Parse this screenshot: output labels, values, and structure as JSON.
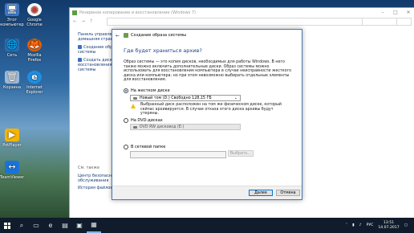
{
  "desktop": {
    "icons": [
      {
        "label": "Этот компьютер",
        "glyph": "🖥"
      },
      {
        "label": "Google Chrome",
        "glyph": "◉"
      },
      {
        "label": "Сеть",
        "glyph": "🌐"
      },
      {
        "label": "Mozilla Firefox",
        "glyph": "🦊"
      },
      {
        "label": "Корзина",
        "glyph": "🗑"
      },
      {
        "label": "Internet Explorer",
        "glyph": "e"
      },
      {
        "label": "PotPlayer",
        "glyph": "▶"
      },
      {
        "label": "TeamViewer",
        "glyph": "↔"
      }
    ]
  },
  "bg_window": {
    "title": "Резервное копирование и восстановление (Windows 7)",
    "left_pane": [
      "Панель управления — домашняя страница",
      "Создание образа системы",
      "Создать диск восстановления системы"
    ],
    "see_also_header": "См. также",
    "see_also": [
      "Центр безопасности и обслуживания",
      "История файлов"
    ]
  },
  "dialog": {
    "title": "Создание образа системы",
    "heading": "Где будет храниться архив?",
    "intro": "Образ системы — это копия дисков, необходимых для работы Windows. В него также можно включить дополнительные диски. Образ системы можно использовать для восстановления компьютера в случае неисправности жесткого диска или компьютера; но при этом невозможно выбирать отдельные элементы для восстановления.",
    "option_hdd": "На жестком диске",
    "hdd_selected": "Новый том (D:) Свободно 128,15 ГБ",
    "warning": "Выбранный диск расположен на том же физическом диске, который сейчас архивируется. В случае отказа этого диска архивы будут утеряны.",
    "option_dvd": "На DVD-дисках",
    "dvd_selected": "DVD RW дисковод (E:)",
    "option_net": "В сетевой папке",
    "browse_label": "Выбрать...",
    "next_label": "Далее",
    "cancel_label": "Отмена"
  },
  "taskbar": {
    "time": "13:51",
    "date": "14.07.2017",
    "lang": "РУС"
  }
}
